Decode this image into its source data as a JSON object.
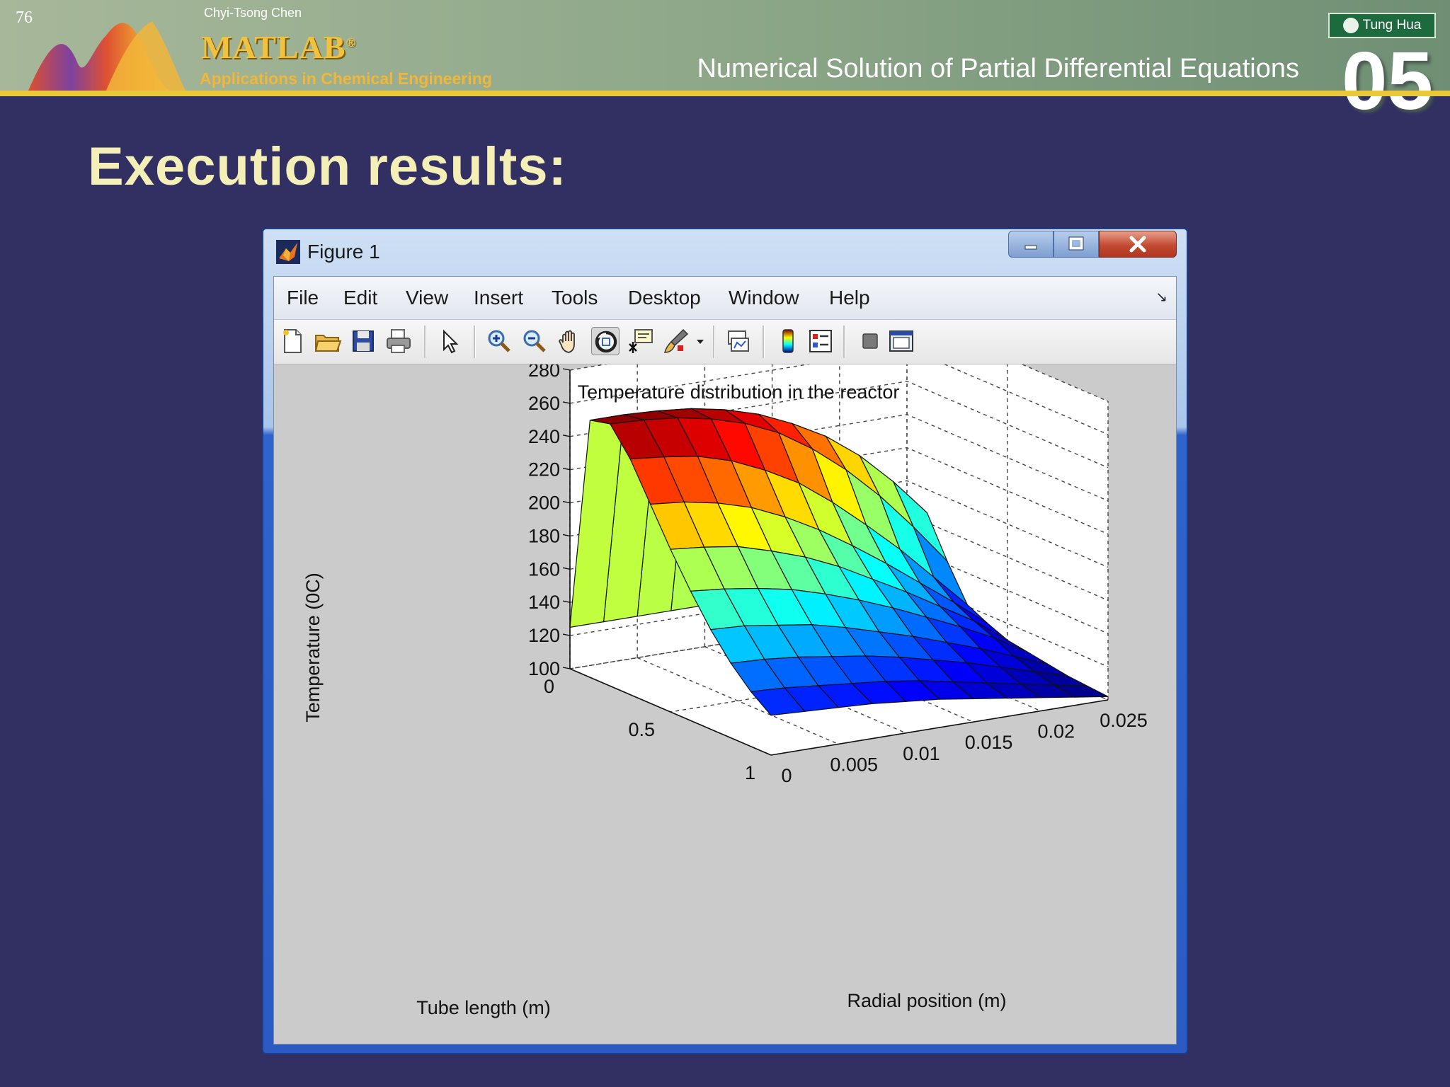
{
  "slide": {
    "page_number": "76",
    "author": "Chyi-Tsong Chen",
    "brand": "MATLAB",
    "brand_mark": "®",
    "brand_subtitle": "Applications in Chemical Engineering",
    "chapter_title": "Numerical Solution of Partial Differential Equations",
    "chapter_number": "05",
    "publisher": "Tung Hua",
    "title": "Execution results:"
  },
  "window": {
    "title": "Figure 1",
    "icon": "matlab-icon",
    "controls": [
      "minimize-icon",
      "maximize-icon",
      "close-icon"
    ]
  },
  "menu": {
    "items": [
      "File",
      "Edit",
      "View",
      "Insert",
      "Tools",
      "Desktop",
      "Window",
      "Help"
    ],
    "overflow_icon": "dock-arrow-icon"
  },
  "toolbar": {
    "icons": [
      "new-figure-icon",
      "open-file-icon",
      "save-icon",
      "print-icon",
      "edit-plot-icon",
      "zoom-in-icon",
      "zoom-out-icon",
      "pan-icon",
      "rotate-3d-icon",
      "data-cursor-icon",
      "brush-icon",
      "link-plot-icon",
      "colorbar-icon",
      "legend-icon",
      "hide-plot-tools-icon",
      "show-plot-tools-icon"
    ],
    "active": "rotate-3d-icon"
  },
  "chart_data": {
    "type": "surface",
    "title": "Temperature distribution in the reactor",
    "xlabel": "Radial position (m)",
    "ylabel": "Tube length (m)",
    "zlabel": "Temperature (0C)",
    "x_ticks": [
      "0",
      "0.005",
      "0.01",
      "0.015",
      "0.02",
      "0.025"
    ],
    "y_ticks": [
      "0",
      "0.5",
      "1"
    ],
    "z_ticks": [
      "100",
      "120",
      "140",
      "160",
      "180",
      "200",
      "220",
      "240",
      "260",
      "280"
    ],
    "xlim": [
      0,
      0.025
    ],
    "ylim": [
      0,
      1
    ],
    "zlim": [
      100,
      280
    ],
    "colormap": "jet",
    "grid": true,
    "x": [
      0,
      0.0025,
      0.005,
      0.0075,
      0.01,
      0.0125,
      0.015,
      0.0175,
      0.02,
      0.0225,
      0.025
    ],
    "y": [
      0,
      0.1,
      0.2,
      0.3,
      0.4,
      0.5,
      0.6,
      0.7,
      0.8,
      0.9,
      1
    ],
    "z": [
      [
        125,
        125,
        125,
        125,
        125,
        125,
        125,
        125,
        125,
        125,
        125
      ],
      [
        255,
        255,
        254,
        252,
        248,
        242,
        233,
        222,
        207,
        188,
        166
      ],
      [
        258,
        257,
        255,
        251,
        245,
        236,
        223,
        207,
        188,
        166,
        142
      ],
      [
        242,
        240,
        237,
        231,
        222,
        211,
        196,
        179,
        161,
        141,
        121
      ],
      [
        220,
        218,
        214,
        208,
        199,
        188,
        175,
        161,
        146,
        131,
        115
      ],
      [
        198,
        196,
        193,
        187,
        180,
        171,
        160,
        149,
        137,
        125,
        110
      ],
      [
        178,
        176,
        173,
        169,
        163,
        156,
        148,
        139,
        130,
        120,
        108
      ],
      [
        160,
        159,
        156,
        153,
        148,
        142,
        136,
        129,
        122,
        114,
        106
      ],
      [
        145,
        144,
        142,
        139,
        136,
        132,
        127,
        122,
        116,
        110,
        104
      ],
      [
        133,
        132,
        130,
        128,
        126,
        123,
        119,
        115,
        111,
        107,
        103
      ],
      [
        124,
        123,
        122,
        121,
        119,
        117,
        114,
        111,
        108,
        105,
        102
      ]
    ]
  }
}
